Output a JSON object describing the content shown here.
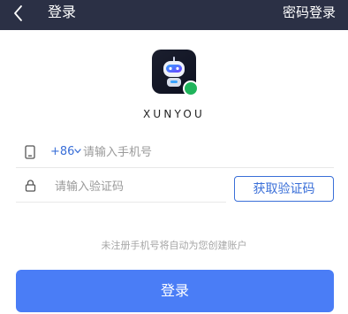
{
  "header": {
    "title": "登录",
    "right_action": "密码登录"
  },
  "app": {
    "brand_name": "XUNYOU"
  },
  "phone": {
    "country_code": "+86",
    "placeholder": "请输入手机号",
    "value": ""
  },
  "code": {
    "placeholder": "请输入验证码",
    "value": "",
    "get_code_label": "获取验证码"
  },
  "notice": "未注册手机号将自动为您创建账户",
  "login_label": "登录",
  "colors": {
    "header_bg": "#2b3045",
    "accent": "#3a6fd8",
    "login_button": "#4a7df6"
  },
  "icons": {
    "back": "chevron-left-icon",
    "phone": "phone-icon",
    "lock": "lock-icon",
    "dropdown": "chevron-down-icon"
  }
}
